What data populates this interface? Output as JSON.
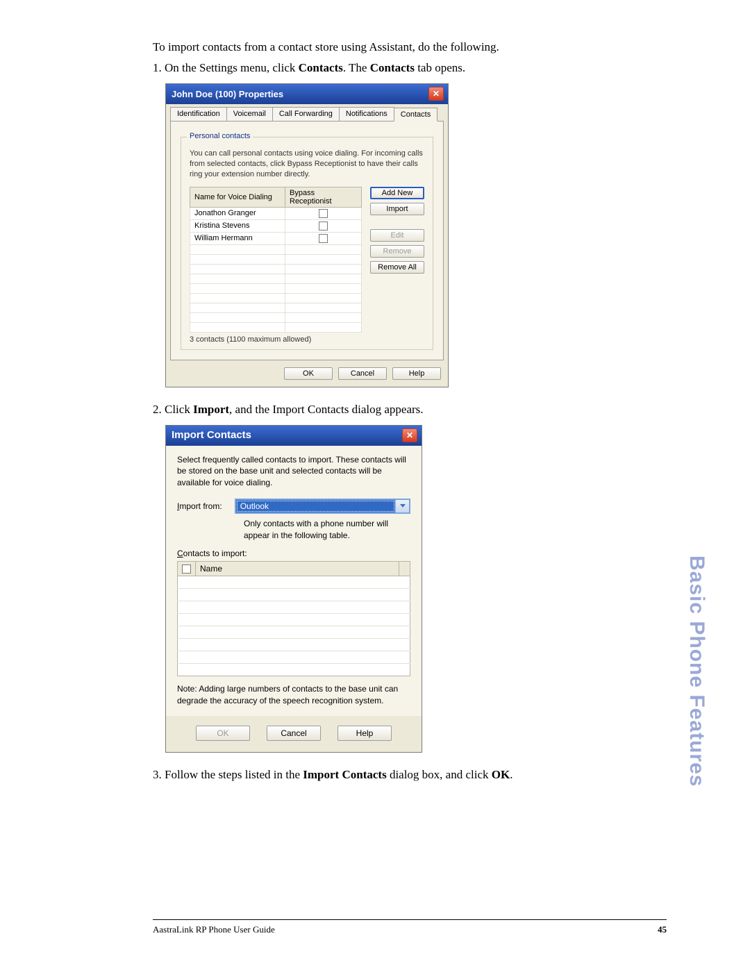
{
  "intro_text": "To import contacts from a contact store using Assistant, do the following.",
  "step1": {
    "num": "1.",
    "pre": " On the Settings menu, click ",
    "bold1": "Contacts",
    "mid": ". The ",
    "bold2": "Contacts",
    "post": " tab opens."
  },
  "props_dialog": {
    "title": "John Doe (100) Properties",
    "tabs": [
      "Identification",
      "Voicemail",
      "Call Forwarding",
      "Notifications",
      "Contacts"
    ],
    "legend": "Personal contacts",
    "desc": "You can call personal contacts using voice dialing.  For incoming calls from selected contacts, click Bypass Receptionist to have their calls ring your extension number directly.",
    "col_name": "Name for Voice Dialing",
    "col_bypass": "Bypass Receptionist",
    "rows": [
      "Jonathon Granger",
      "Kristina Stevens",
      "William Hermann"
    ],
    "buttons": {
      "add_new": "Add New",
      "import": "Import",
      "edit": "Edit",
      "remove": "Remove",
      "remove_all": "Remove All"
    },
    "hint": "3 contacts (1100 maximum allowed)",
    "ok": "OK",
    "cancel": "Cancel",
    "help": "Help"
  },
  "step2": {
    "num": "2.",
    "pre": " Click ",
    "bold1": "Import",
    "post": ", and the Import Contacts dialog appears."
  },
  "import_dialog": {
    "title": "Import Contacts",
    "para": "Select frequently called contacts to import.  These contacts will be stored on the base unit and selected contacts will be available for voice dialing.",
    "import_from_label_pre": "I",
    "import_from_label_post": "mport from:",
    "select_value": "Outlook",
    "only_note": "Only contacts with a phone number will appear in the following table.",
    "contacts_to_import_pre": "C",
    "contacts_to_import_post": "ontacts to import:",
    "col_name": "Name",
    "warn": "Note:  Adding large numbers of contacts to the base unit can degrade the accuracy of the speech recognition system.",
    "ok": "OK",
    "cancel": "Cancel",
    "help": "Help"
  },
  "step3": {
    "num": "3.",
    "pre": " Follow the steps listed in the ",
    "bold1": "Import Contacts",
    "mid": " dialog box, and click ",
    "bold2": "OK",
    "post": "."
  },
  "side_text": "Basic Phone Features",
  "footer_left": "AastraLink RP Phone User Guide",
  "footer_page": "45"
}
